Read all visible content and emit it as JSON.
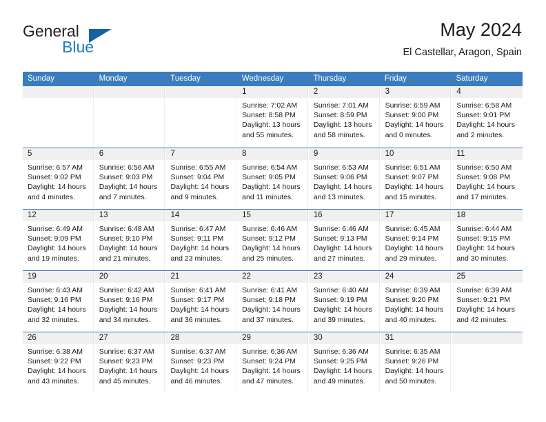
{
  "brand": {
    "name_part1": "General",
    "name_part2": "Blue",
    "accent_color": "#1f7ec4",
    "triangle_color": "#1464a5"
  },
  "header": {
    "title": "May 2024",
    "subtitle": "El Castellar, Aragon, Spain"
  },
  "theme": {
    "header_bar_color": "#3a7cbd",
    "daynum_band_color": "#f0f0f0",
    "text_color": "#1a1a1a"
  },
  "weekdays": [
    "Sunday",
    "Monday",
    "Tuesday",
    "Wednesday",
    "Thursday",
    "Friday",
    "Saturday"
  ],
  "weeks": [
    [
      {
        "day": "",
        "sunrise": "",
        "sunset": "",
        "daylight_1": "",
        "daylight_2": "",
        "empty": true
      },
      {
        "day": "",
        "sunrise": "",
        "sunset": "",
        "daylight_1": "",
        "daylight_2": "",
        "empty": true
      },
      {
        "day": "",
        "sunrise": "",
        "sunset": "",
        "daylight_1": "",
        "daylight_2": "",
        "empty": true
      },
      {
        "day": "1",
        "sunrise": "Sunrise: 7:02 AM",
        "sunset": "Sunset: 8:58 PM",
        "daylight_1": "Daylight: 13 hours",
        "daylight_2": "and 55 minutes."
      },
      {
        "day": "2",
        "sunrise": "Sunrise: 7:01 AM",
        "sunset": "Sunset: 8:59 PM",
        "daylight_1": "Daylight: 13 hours",
        "daylight_2": "and 58 minutes."
      },
      {
        "day": "3",
        "sunrise": "Sunrise: 6:59 AM",
        "sunset": "Sunset: 9:00 PM",
        "daylight_1": "Daylight: 14 hours",
        "daylight_2": "and 0 minutes."
      },
      {
        "day": "4",
        "sunrise": "Sunrise: 6:58 AM",
        "sunset": "Sunset: 9:01 PM",
        "daylight_1": "Daylight: 14 hours",
        "daylight_2": "and 2 minutes."
      }
    ],
    [
      {
        "day": "5",
        "sunrise": "Sunrise: 6:57 AM",
        "sunset": "Sunset: 9:02 PM",
        "daylight_1": "Daylight: 14 hours",
        "daylight_2": "and 4 minutes."
      },
      {
        "day": "6",
        "sunrise": "Sunrise: 6:56 AM",
        "sunset": "Sunset: 9:03 PM",
        "daylight_1": "Daylight: 14 hours",
        "daylight_2": "and 7 minutes."
      },
      {
        "day": "7",
        "sunrise": "Sunrise: 6:55 AM",
        "sunset": "Sunset: 9:04 PM",
        "daylight_1": "Daylight: 14 hours",
        "daylight_2": "and 9 minutes."
      },
      {
        "day": "8",
        "sunrise": "Sunrise: 6:54 AM",
        "sunset": "Sunset: 9:05 PM",
        "daylight_1": "Daylight: 14 hours",
        "daylight_2": "and 11 minutes."
      },
      {
        "day": "9",
        "sunrise": "Sunrise: 6:53 AM",
        "sunset": "Sunset: 9:06 PM",
        "daylight_1": "Daylight: 14 hours",
        "daylight_2": "and 13 minutes."
      },
      {
        "day": "10",
        "sunrise": "Sunrise: 6:51 AM",
        "sunset": "Sunset: 9:07 PM",
        "daylight_1": "Daylight: 14 hours",
        "daylight_2": "and 15 minutes."
      },
      {
        "day": "11",
        "sunrise": "Sunrise: 6:50 AM",
        "sunset": "Sunset: 9:08 PM",
        "daylight_1": "Daylight: 14 hours",
        "daylight_2": "and 17 minutes."
      }
    ],
    [
      {
        "day": "12",
        "sunrise": "Sunrise: 6:49 AM",
        "sunset": "Sunset: 9:09 PM",
        "daylight_1": "Daylight: 14 hours",
        "daylight_2": "and 19 minutes."
      },
      {
        "day": "13",
        "sunrise": "Sunrise: 6:48 AM",
        "sunset": "Sunset: 9:10 PM",
        "daylight_1": "Daylight: 14 hours",
        "daylight_2": "and 21 minutes."
      },
      {
        "day": "14",
        "sunrise": "Sunrise: 6:47 AM",
        "sunset": "Sunset: 9:11 PM",
        "daylight_1": "Daylight: 14 hours",
        "daylight_2": "and 23 minutes."
      },
      {
        "day": "15",
        "sunrise": "Sunrise: 6:46 AM",
        "sunset": "Sunset: 9:12 PM",
        "daylight_1": "Daylight: 14 hours",
        "daylight_2": "and 25 minutes."
      },
      {
        "day": "16",
        "sunrise": "Sunrise: 6:46 AM",
        "sunset": "Sunset: 9:13 PM",
        "daylight_1": "Daylight: 14 hours",
        "daylight_2": "and 27 minutes."
      },
      {
        "day": "17",
        "sunrise": "Sunrise: 6:45 AM",
        "sunset": "Sunset: 9:14 PM",
        "daylight_1": "Daylight: 14 hours",
        "daylight_2": "and 29 minutes."
      },
      {
        "day": "18",
        "sunrise": "Sunrise: 6:44 AM",
        "sunset": "Sunset: 9:15 PM",
        "daylight_1": "Daylight: 14 hours",
        "daylight_2": "and 30 minutes."
      }
    ],
    [
      {
        "day": "19",
        "sunrise": "Sunrise: 6:43 AM",
        "sunset": "Sunset: 9:16 PM",
        "daylight_1": "Daylight: 14 hours",
        "daylight_2": "and 32 minutes."
      },
      {
        "day": "20",
        "sunrise": "Sunrise: 6:42 AM",
        "sunset": "Sunset: 9:16 PM",
        "daylight_1": "Daylight: 14 hours",
        "daylight_2": "and 34 minutes."
      },
      {
        "day": "21",
        "sunrise": "Sunrise: 6:41 AM",
        "sunset": "Sunset: 9:17 PM",
        "daylight_1": "Daylight: 14 hours",
        "daylight_2": "and 36 minutes."
      },
      {
        "day": "22",
        "sunrise": "Sunrise: 6:41 AM",
        "sunset": "Sunset: 9:18 PM",
        "daylight_1": "Daylight: 14 hours",
        "daylight_2": "and 37 minutes."
      },
      {
        "day": "23",
        "sunrise": "Sunrise: 6:40 AM",
        "sunset": "Sunset: 9:19 PM",
        "daylight_1": "Daylight: 14 hours",
        "daylight_2": "and 39 minutes."
      },
      {
        "day": "24",
        "sunrise": "Sunrise: 6:39 AM",
        "sunset": "Sunset: 9:20 PM",
        "daylight_1": "Daylight: 14 hours",
        "daylight_2": "and 40 minutes."
      },
      {
        "day": "25",
        "sunrise": "Sunrise: 6:39 AM",
        "sunset": "Sunset: 9:21 PM",
        "daylight_1": "Daylight: 14 hours",
        "daylight_2": "and 42 minutes."
      }
    ],
    [
      {
        "day": "26",
        "sunrise": "Sunrise: 6:38 AM",
        "sunset": "Sunset: 9:22 PM",
        "daylight_1": "Daylight: 14 hours",
        "daylight_2": "and 43 minutes."
      },
      {
        "day": "27",
        "sunrise": "Sunrise: 6:37 AM",
        "sunset": "Sunset: 9:23 PM",
        "daylight_1": "Daylight: 14 hours",
        "daylight_2": "and 45 minutes."
      },
      {
        "day": "28",
        "sunrise": "Sunrise: 6:37 AM",
        "sunset": "Sunset: 9:23 PM",
        "daylight_1": "Daylight: 14 hours",
        "daylight_2": "and 46 minutes."
      },
      {
        "day": "29",
        "sunrise": "Sunrise: 6:36 AM",
        "sunset": "Sunset: 9:24 PM",
        "daylight_1": "Daylight: 14 hours",
        "daylight_2": "and 47 minutes."
      },
      {
        "day": "30",
        "sunrise": "Sunrise: 6:36 AM",
        "sunset": "Sunset: 9:25 PM",
        "daylight_1": "Daylight: 14 hours",
        "daylight_2": "and 49 minutes."
      },
      {
        "day": "31",
        "sunrise": "Sunrise: 6:35 AM",
        "sunset": "Sunset: 9:26 PM",
        "daylight_1": "Daylight: 14 hours",
        "daylight_2": "and 50 minutes."
      },
      {
        "day": "",
        "sunrise": "",
        "sunset": "",
        "daylight_1": "",
        "daylight_2": "",
        "empty": true
      }
    ]
  ]
}
